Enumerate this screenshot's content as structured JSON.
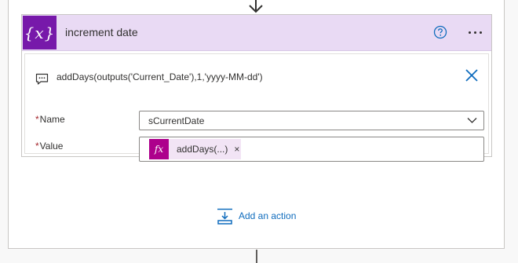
{
  "action_card": {
    "title": "increment date",
    "icon_symbol": "{x}",
    "icon_name": "variable-icon",
    "header_color": "#e9daf4",
    "icon_color": "#7719aa",
    "help_icon": "question-circle-icon",
    "more_icon": "ellipsis-icon"
  },
  "comment": {
    "text": "addDays(outputs('Current_Date'),1,'yyyy-MM-dd')",
    "icon": "comment-icon",
    "close_icon": "close-icon"
  },
  "fields": {
    "name": {
      "required_marker": "*",
      "label": "Name",
      "value": "sCurrentDate"
    },
    "value": {
      "required_marker": "*",
      "label": "Value",
      "token_symbol": "fx",
      "token_label": "addDays(...)",
      "token_remove": "×",
      "token_color": "#ad008c"
    }
  },
  "footer": {
    "add_action_label": "Add an action",
    "add_action_icon": "insert-action-icon",
    "link_color": "#0f6cbd"
  }
}
